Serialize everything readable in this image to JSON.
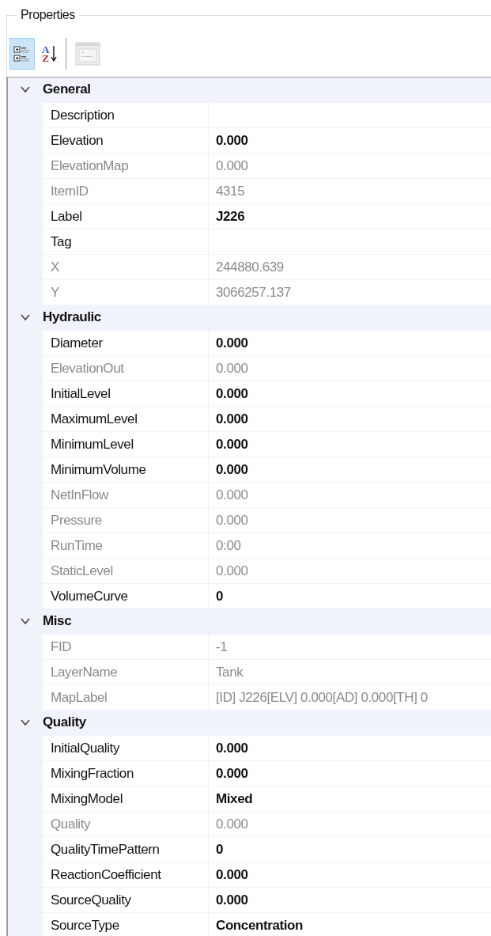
{
  "panel": {
    "title": "Properties"
  },
  "toolbar": [
    {
      "kind": "categorized",
      "selected": true,
      "disabled": false
    },
    {
      "kind": "alphabetical",
      "selected": false,
      "disabled": false,
      "letters": [
        "A",
        "Z"
      ]
    },
    {
      "kind": "property-pages",
      "selected": false,
      "disabled": true
    }
  ],
  "categories": [
    {
      "name": "General",
      "expanded": true,
      "properties": [
        {
          "name": "Description",
          "readonly": false,
          "modified": false
        },
        {
          "name": "Elevation",
          "value": "0.000",
          "readonly": false,
          "modified": true
        },
        {
          "name": "ElevationMap",
          "value": "0.000",
          "readonly": true,
          "modified": false
        },
        {
          "name": "ItemID",
          "value": "4315",
          "readonly": true,
          "modified": false
        },
        {
          "name": "Label",
          "value": "J226",
          "readonly": false,
          "modified": true
        },
        {
          "name": "Tag",
          "readonly": false,
          "modified": false
        },
        {
          "name": "X",
          "value": "244880.639",
          "readonly": true,
          "modified": false
        },
        {
          "name": "Y",
          "value": "3066257.137",
          "readonly": true,
          "modified": false
        }
      ]
    },
    {
      "name": "Hydraulic",
      "expanded": true,
      "properties": [
        {
          "name": "Diameter",
          "value": "0.000",
          "readonly": false,
          "modified": true
        },
        {
          "name": "ElevationOut",
          "value": "0.000",
          "readonly": true,
          "modified": false
        },
        {
          "name": "InitialLevel",
          "value": "0.000",
          "readonly": false,
          "modified": true
        },
        {
          "name": "MaximumLevel",
          "value": "0.000",
          "readonly": false,
          "modified": true
        },
        {
          "name": "MinimumLevel",
          "value": "0.000",
          "readonly": false,
          "modified": true
        },
        {
          "name": "MinimumVolume",
          "value": "0.000",
          "readonly": false,
          "modified": true
        },
        {
          "name": "NetInFlow",
          "value": "0.000",
          "readonly": true,
          "modified": false
        },
        {
          "name": "Pressure",
          "value": "0.000",
          "readonly": true,
          "modified": false
        },
        {
          "name": "RunTime",
          "value": "0:00",
          "readonly": true,
          "modified": false
        },
        {
          "name": "StaticLevel",
          "value": "0.000",
          "readonly": true,
          "modified": false
        },
        {
          "name": "VolumeCurve",
          "value": "0",
          "readonly": false,
          "modified": true
        }
      ]
    },
    {
      "name": "Misc",
      "expanded": true,
      "properties": [
        {
          "name": "FID",
          "value": "-1",
          "readonly": true,
          "modified": false
        },
        {
          "name": "LayerName",
          "value": "Tank",
          "readonly": true,
          "modified": false
        },
        {
          "name": "MapLabel",
          "value": "[ID] J226[ELV] 0.000[AD] 0.000[TH] 0",
          "readonly": true,
          "modified": false
        }
      ]
    },
    {
      "name": "Quality",
      "expanded": true,
      "properties": [
        {
          "name": "InitialQuality",
          "value": "0.000",
          "readonly": false,
          "modified": true
        },
        {
          "name": "MixingFraction",
          "value": "0.000",
          "readonly": false,
          "modified": true
        },
        {
          "name": "MixingModel",
          "value": "Mixed",
          "readonly": false,
          "modified": true
        },
        {
          "name": "Quality",
          "value": "0.000",
          "readonly": true,
          "modified": false
        },
        {
          "name": "QualityTimePattern",
          "value": "0",
          "readonly": false,
          "modified": true
        },
        {
          "name": "ReactionCoefficient",
          "value": "0.000",
          "readonly": false,
          "modified": true
        },
        {
          "name": "SourceQuality",
          "value": "0.000",
          "readonly": false,
          "modified": true
        },
        {
          "name": "SourceType",
          "value": "Concentration",
          "readonly": false,
          "modified": true
        }
      ]
    }
  ]
}
